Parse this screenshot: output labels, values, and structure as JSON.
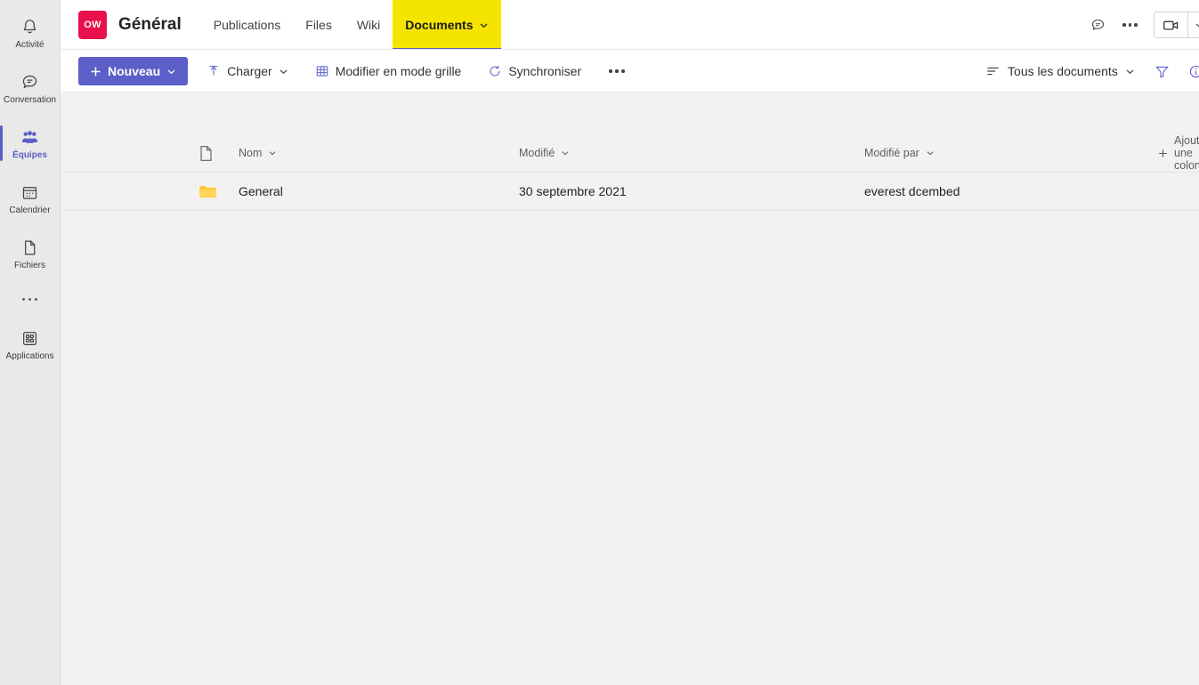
{
  "rail": {
    "items": [
      {
        "label": "Activité",
        "icon": "bell-icon",
        "active": false
      },
      {
        "label": "Conversation",
        "icon": "chat-icon",
        "active": false
      },
      {
        "label": "Équipes",
        "icon": "teams-people-icon",
        "active": true
      },
      {
        "label": "Calendrier",
        "icon": "calendar-icon",
        "active": false
      },
      {
        "label": "Fichiers",
        "icon": "file-icon",
        "active": false
      }
    ],
    "more_label": "…",
    "apps": {
      "label": "Applications",
      "icon": "apps-grid-icon"
    }
  },
  "header": {
    "avatar_initials": "OW",
    "avatar_color": "#e8114b",
    "team_name": "Général",
    "tabs": [
      {
        "label": "Publications",
        "active": false,
        "has_caret": false
      },
      {
        "label": "Files",
        "active": false,
        "has_caret": false
      },
      {
        "label": "Wiki",
        "active": false,
        "has_caret": false
      },
      {
        "label": "Documents",
        "active": true,
        "has_caret": true,
        "highlight_color": "#f5e400",
        "underline_color": "#5b5fc7"
      }
    ],
    "right": {
      "chat_icon": "chat-bubble-icon",
      "more_icon": "more-horizontal-icon",
      "meet_icon": "video-camera-icon",
      "meet_caret_icon": "chevron-down-icon"
    }
  },
  "commandbar": {
    "new_button": {
      "label": "Nouveau",
      "plus_icon": "plus-icon",
      "caret_icon": "chevron-down-icon",
      "color": "#5b5fc7"
    },
    "items": [
      {
        "label": "Charger",
        "icon": "upload-icon",
        "has_caret": true
      },
      {
        "label": "Modifier en mode grille",
        "icon": "grid-table-icon",
        "has_caret": false
      },
      {
        "label": "Synchroniser",
        "icon": "sync-icon",
        "has_caret": false
      }
    ],
    "overflow_icon": "more-horizontal-icon",
    "view_selector": {
      "label": "Tous les documents",
      "icon": "list-view-icon",
      "caret_icon": "chevron-down-icon"
    },
    "filter_icon": "filter-funnel-icon",
    "info_icon": "information-circle-icon"
  },
  "filelist": {
    "columns": [
      {
        "key": "icon",
        "label": "",
        "icon": "document-icon"
      },
      {
        "key": "name",
        "label": "Nom",
        "sortable": true
      },
      {
        "key": "modified",
        "label": "Modifié",
        "sortable": true
      },
      {
        "key": "modified_by",
        "label": "Modifié par",
        "sortable": true
      }
    ],
    "add_column": {
      "label": "Ajouter une colonne",
      "icon": "plus-icon"
    },
    "rows": [
      {
        "icon": "folder-icon",
        "icon_color": "#fcc72f",
        "name": "General",
        "modified": "30 septembre 2021",
        "modified_by": "everest dcembed"
      }
    ]
  }
}
